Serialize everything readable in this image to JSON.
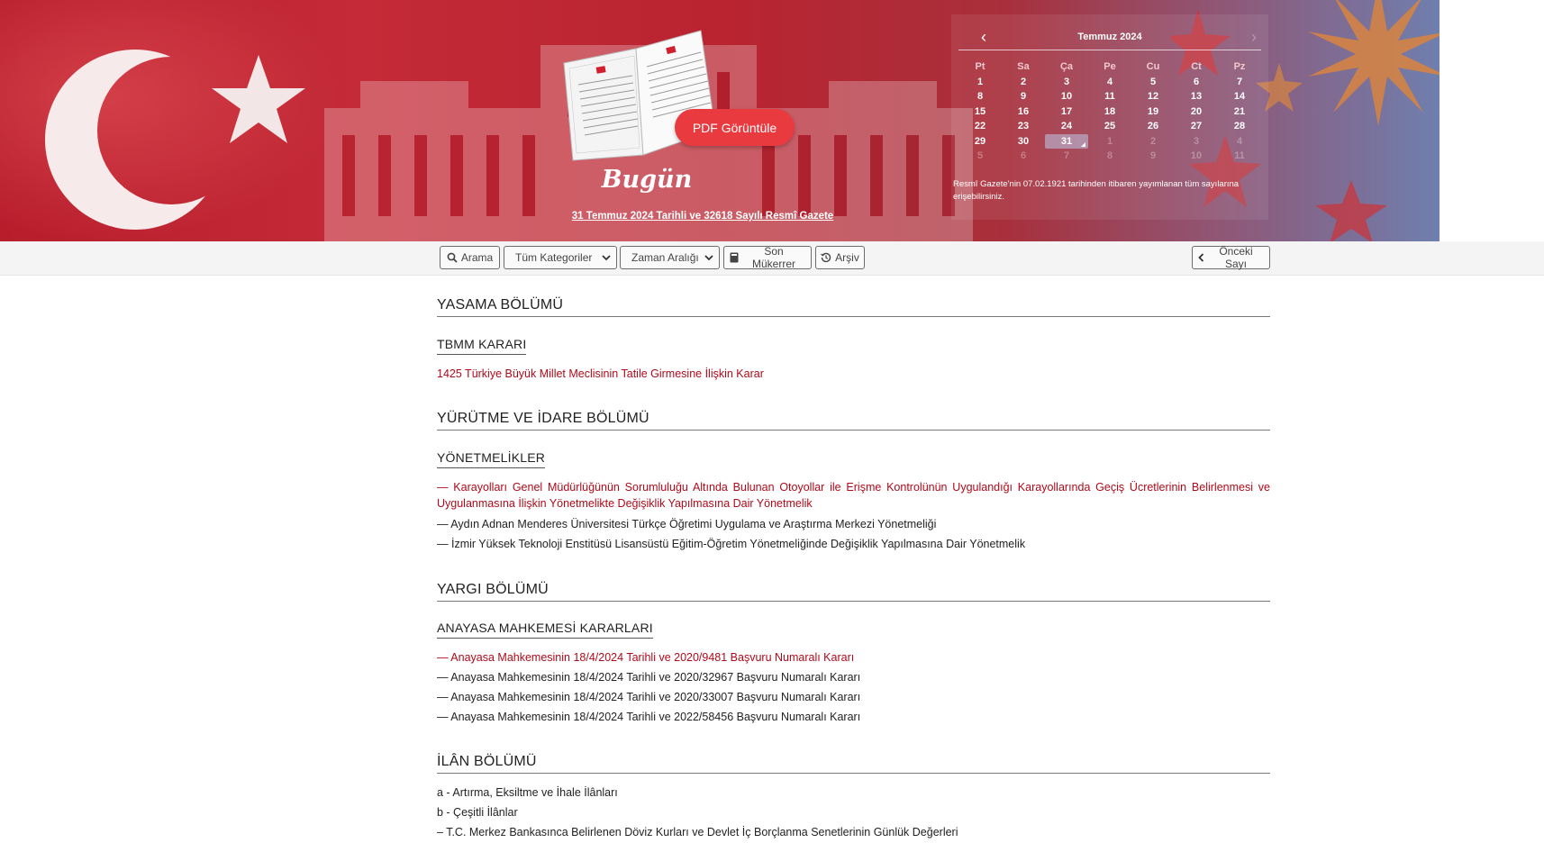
{
  "header": {
    "pdf_button_label": "PDF Görüntüle",
    "today_label": "Bugün",
    "today_link": "31 Temmuz 2024 Tarihli ve 32618 Sayılı Resmî Gazete"
  },
  "calendar": {
    "month_label": "Temmuz 2024",
    "weekdays": [
      "Pt",
      "Sa",
      "Ça",
      "Pe",
      "Cu",
      "Ct",
      "Pz"
    ],
    "rows": [
      [
        "1",
        "2",
        "3",
        "4",
        "5",
        "6",
        "7"
      ],
      [
        "8",
        "9",
        "10",
        "11",
        "12",
        "13",
        "14"
      ],
      [
        "15",
        "16",
        "17",
        "18",
        "19",
        "20",
        "21"
      ],
      [
        "22",
        "23",
        "24",
        "25",
        "26",
        "27",
        "28"
      ],
      [
        "29",
        "30",
        "31",
        "1",
        "2",
        "3",
        "4"
      ],
      [
        "5",
        "6",
        "7",
        "8",
        "9",
        "10",
        "11"
      ]
    ],
    "selected_day": "31",
    "note": "Resmî Gazete'nin 07.02.1921 tarihinden itibaren yayımlanan tüm sayılarına erişebilirsiniz."
  },
  "toolbar": {
    "search_label": "Arama",
    "categories_label": "Tüm Kategoriler",
    "date_range_label": "Zaman Aralığı",
    "repeated_label": "Son Mükerrer",
    "archive_label": "Arşiv",
    "previous_label": "Önceki Sayı"
  },
  "sections": {
    "yasama": {
      "title": "YASAMA BÖLÜMÜ",
      "sub": "TBMM KARARI",
      "items": [
        "1425 Türkiye Büyük Millet Meclisinin Tatile Girmesine İlişkin Karar"
      ]
    },
    "yurutme": {
      "title": "YÜRÜTME VE İDARE BÖLÜMÜ",
      "sub": "YÖNETMELİKLER",
      "items": [
        "— Karayolları Genel Müdürlüğünün Sorumluluğu Altında Bulunan Otoyollar ile Erişme Kontrolünün Uygulandığı Karayollarında Geçiş Ücretlerinin Belirlenmesi ve Uygulanmasına İlişkin Yönetmelikte Değişiklik Yapılmasına Dair Yönetmelik",
        "— Aydın Adnan Menderes Üniversitesi Türkçe Öğretimi Uygulama ve Araştırma Merkezi Yönetmeliği",
        "— İzmir Yüksek Teknoloji Enstitüsü Lisansüstü Eğitim-Öğretim Yönetmeliğinde Değişiklik Yapılmasına Dair Yönetmelik"
      ]
    },
    "yargi": {
      "title": "YARGI BÖLÜMÜ",
      "sub": "ANAYASA MAHKEMESİ KARARLARI",
      "items": [
        "— Anayasa Mahkemesinin 18/4/2024 Tarihli ve 2020/9481 Başvuru Numaralı Kararı",
        "— Anayasa Mahkemesinin 18/4/2024 Tarihli ve 2020/32967 Başvuru Numaralı Kararı",
        "— Anayasa Mahkemesinin 18/4/2024 Tarihli ve 2020/33007 Başvuru Numaralı Kararı",
        "— Anayasa Mahkemesinin 18/4/2024 Tarihli ve 2022/58456 Başvuru Numaralı Kararı"
      ]
    },
    "ilan": {
      "title": "İLÂN BÖLÜMÜ",
      "items": [
        "a - Artırma, Eksiltme ve İhale İlânları",
        "b - Çeşitli İlânlar",
        "– T.C. Merkez Bankasınca Belirlenen Döviz Kurları ve Devlet İç Borçlanma Senetlerinin Günlük Değerleri"
      ]
    }
  },
  "colors": {
    "link_red": "#b00a1a",
    "pdf_button": "#e83a3f",
    "banner_red": "#b81d2c"
  }
}
